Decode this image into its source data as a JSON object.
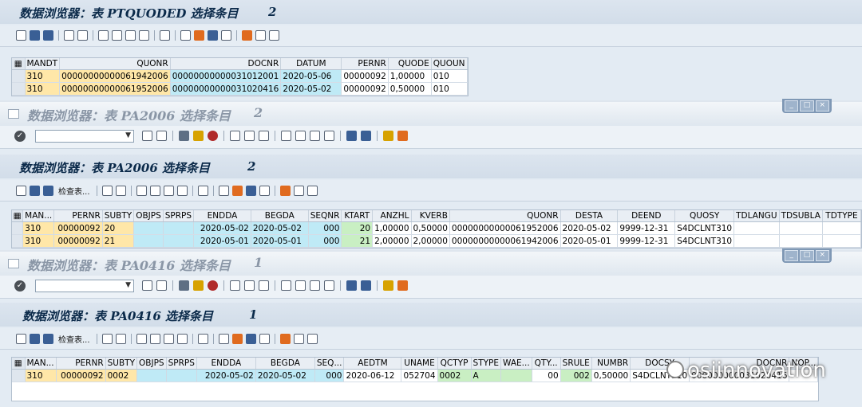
{
  "w1": {
    "title": "数据浏览器：表 PTQUODED 选择条目",
    "count": "2",
    "columns": [
      "MANDT",
      "QUONR",
      "DOCNR",
      "DATUM",
      "PERNR",
      "QUODE",
      "QUOUN"
    ],
    "rows": [
      [
        "310",
        "00000000000061942006",
        "00000000000031012001",
        "2020-05-06",
        "00000092",
        "1,00000",
        "010"
      ],
      [
        "310",
        "00000000000061952006",
        "00000000000031020416",
        "2020-05-02",
        "00000092",
        "0,50000",
        "010"
      ]
    ]
  },
  "w2": {
    "window_title": "数据浏览器：表 PA2006 选择条目",
    "window_count": "2",
    "title": "数据浏览器：表 PA2006 选择条目",
    "count": "2",
    "check_table": "检查表...",
    "columns": [
      "MAN...",
      "PERNR",
      "SUBTY",
      "OBJPS",
      "SPRPS",
      "ENDDA",
      "BEGDA",
      "SEQNR",
      "KTART",
      "ANZHL",
      "KVERB",
      "QUONR",
      "DESTA",
      "DEEND",
      "QUOSY",
      "TDLANGU",
      "TDSUBLA",
      "TDTYPE"
    ],
    "rows": [
      [
        "310",
        "00000092",
        "20",
        "",
        "",
        "2020-05-02",
        "2020-05-02",
        "000",
        "20",
        "1,00000",
        "0,50000",
        "00000000000061952006",
        "2020-05-02",
        "9999-12-31",
        "S4DCLNT310",
        "",
        "",
        ""
      ],
      [
        "310",
        "00000092",
        "21",
        "",
        "",
        "2020-05-01",
        "2020-05-01",
        "000",
        "21",
        "2,00000",
        "2,00000",
        "00000000000061942006",
        "2020-05-01",
        "9999-12-31",
        "S4DCLNT310",
        "",
        "",
        ""
      ]
    ]
  },
  "w3": {
    "window_title": "数据浏览器：表 PA0416 选择条目",
    "window_count": "1",
    "title": "数据浏览器：表 PA0416 选择条目",
    "count": "1",
    "check_table": "检查表...",
    "columns": [
      "MAN...",
      "PERNR",
      "SUBTY",
      "OBJPS",
      "SPRPS",
      "ENDDA",
      "BEGDA",
      "SEQ...",
      "AEDTM",
      "UNAME",
      "QCTYP",
      "STYPE",
      "WAE...",
      "QTY...",
      "SRULE",
      "NUMBR",
      "DOCSY",
      "DOCNR",
      "NOP..."
    ],
    "rows": [
      [
        "310",
        "00000092",
        "0002",
        "",
        "",
        "2020-05-02",
        "2020-05-02",
        "000",
        "2020-06-12",
        "052704",
        "0002",
        "A",
        "",
        "00",
        "002",
        "0,50000",
        "S4DCLNT310",
        "000000000031020416",
        ""
      ]
    ]
  },
  "watermark": "osiinnovation",
  "icons": {
    "ok": "check-icon",
    "dropdown": "chevron-down-icon",
    "window": "window-icon"
  }
}
